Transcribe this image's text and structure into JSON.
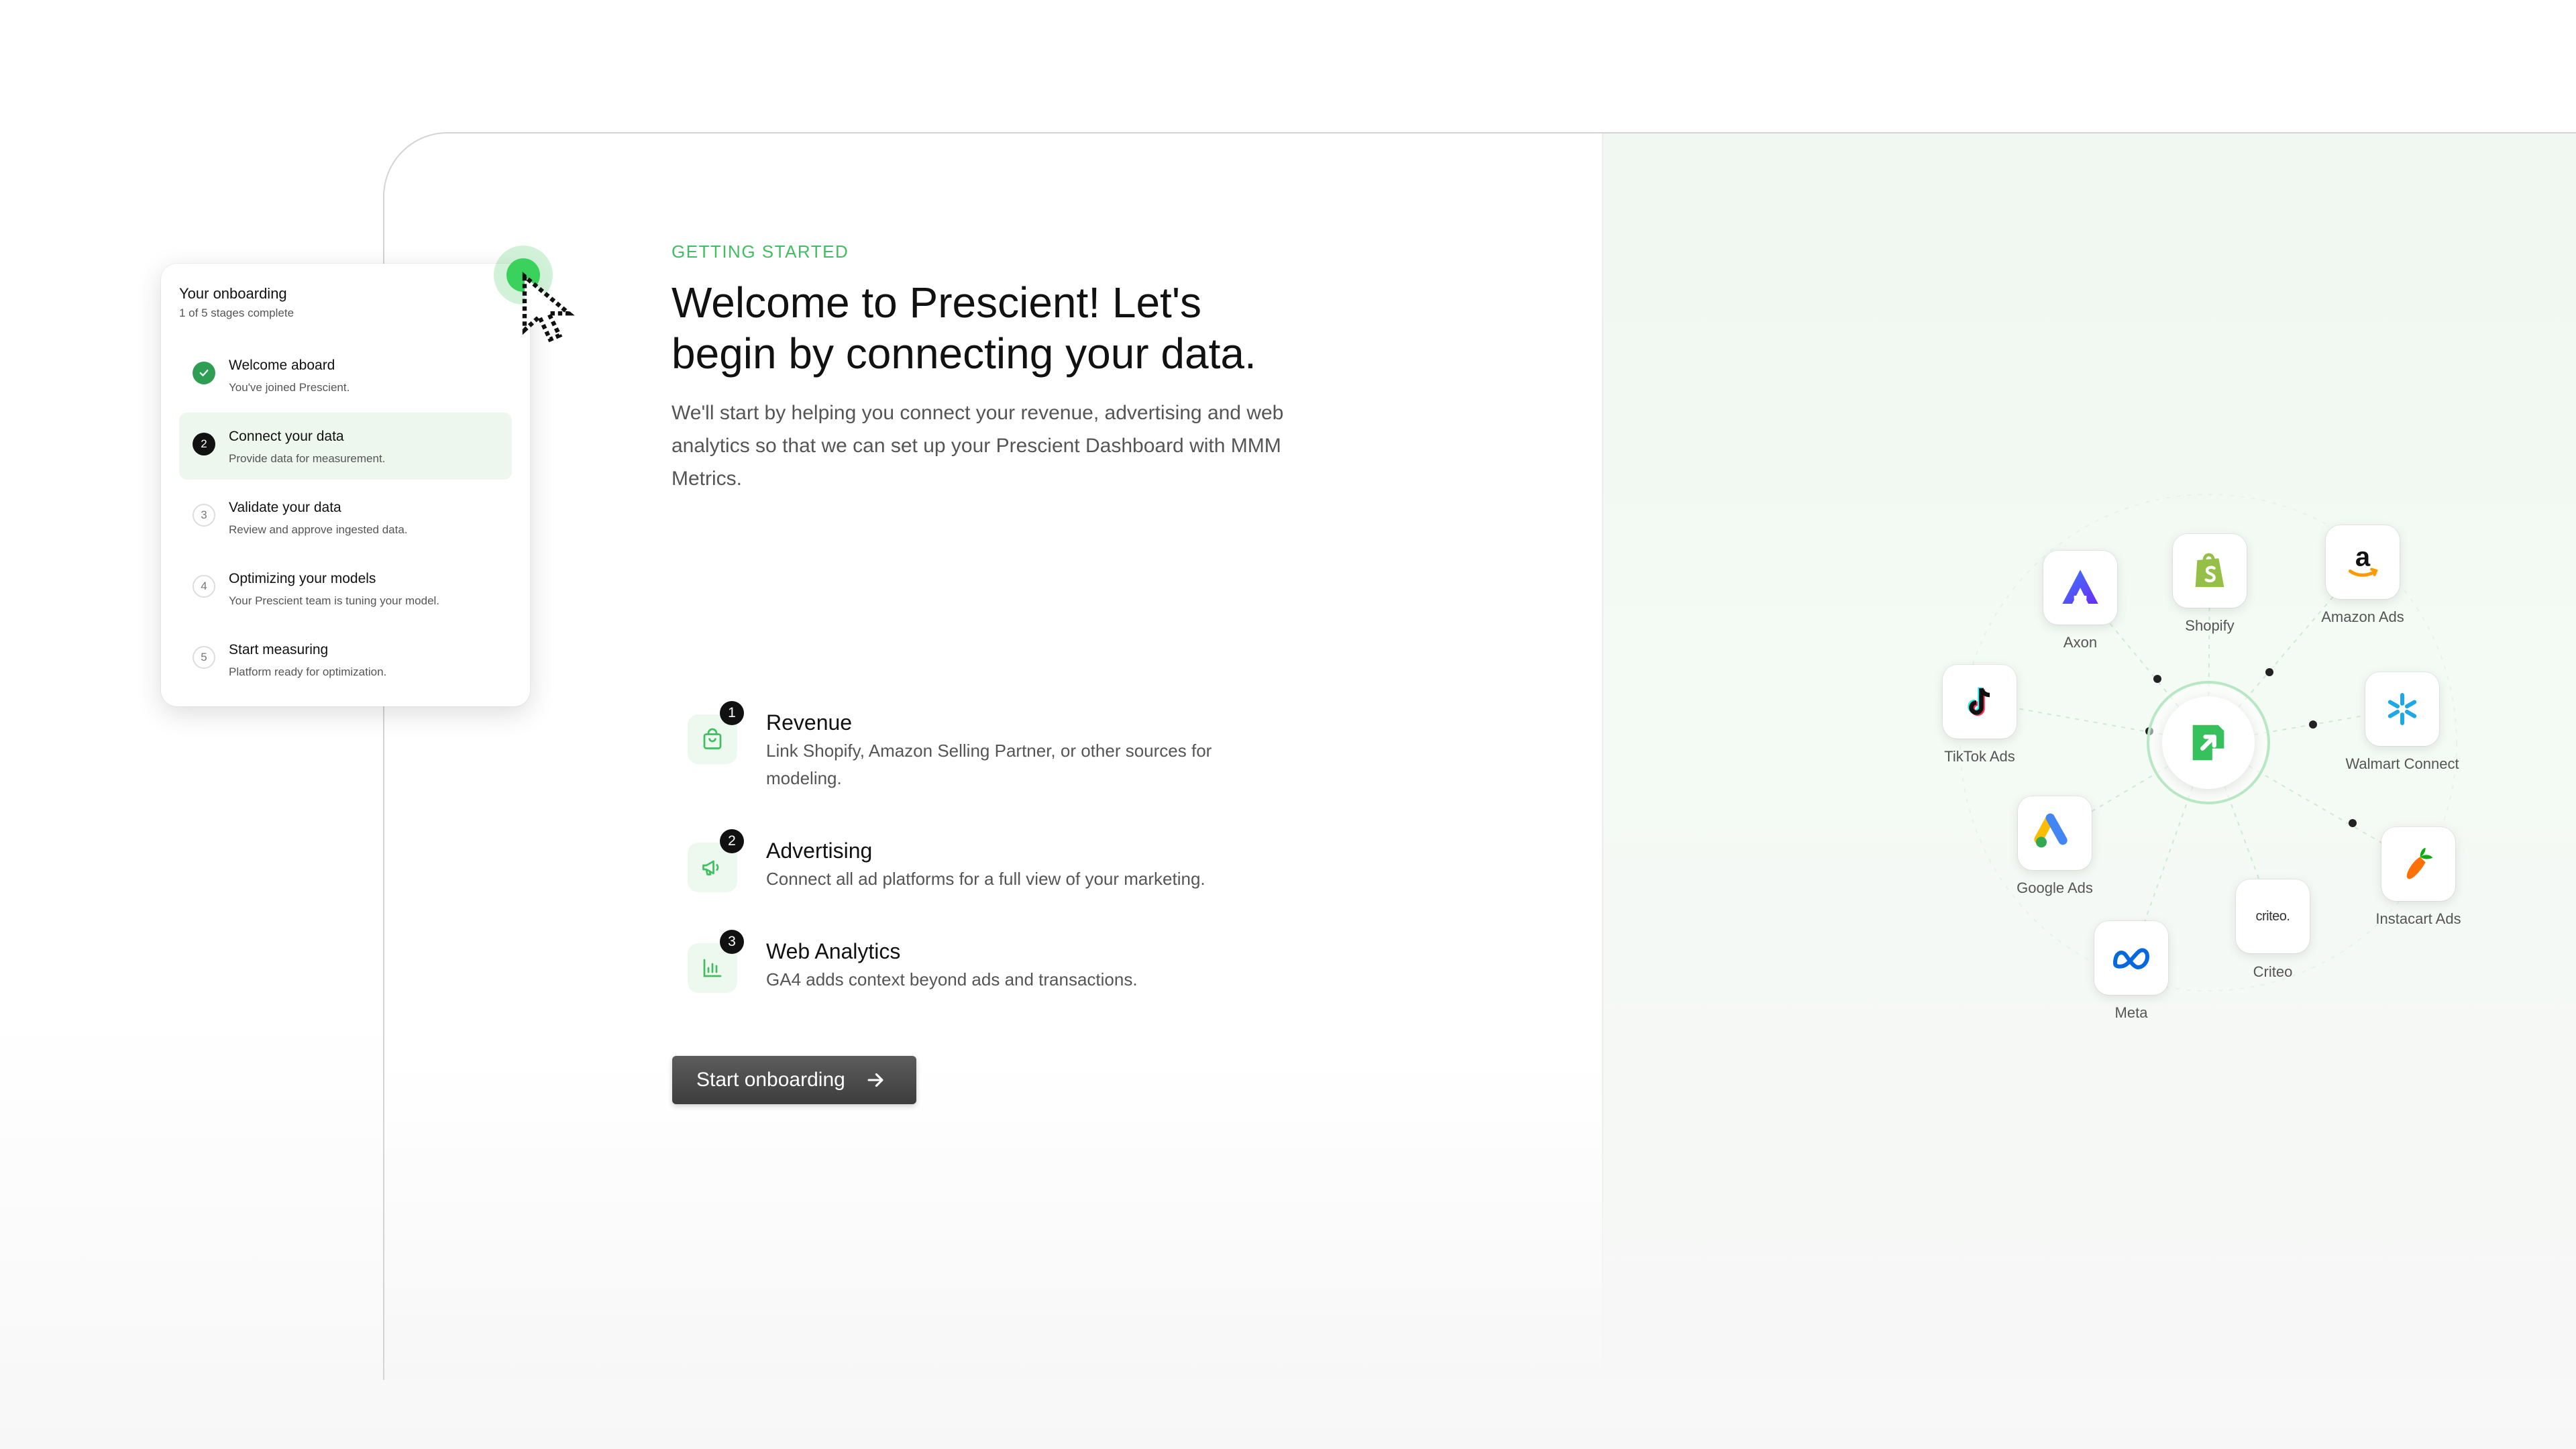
{
  "main": {
    "kicker": "GETTING STARTED",
    "headline_line1": "Welcome to Prescient! Let's",
    "headline_line2": "begin by connecting your data.",
    "intro": "We'll start by helping you connect your revenue, advertising and web analytics so that we can set up your Prescient Dashboard with MMM Metrics.",
    "steps": [
      {
        "number": "1",
        "title": "Revenue",
        "desc_line1": "Link Shopify, Amazon Selling Partner, or other sources for",
        "desc_line2": "modeling.",
        "icon": "shopping-bag-icon"
      },
      {
        "number": "2",
        "title": "Advertising",
        "desc_line1": "Connect all ad platforms for a full view of your marketing.",
        "icon": "megaphone-icon"
      },
      {
        "number": "3",
        "title": "Web Analytics",
        "desc_line1": "GA4 adds context beyond ads and transactions.",
        "icon": "bar-chart-icon"
      }
    ],
    "cta_label": "Start onboarding"
  },
  "onboarding": {
    "title": "Your onboarding",
    "subtitle": "1 of 5 stages complete",
    "items": [
      {
        "number": "",
        "label": "Welcome aboard",
        "desc": "You've joined Prescient.",
        "state": "done"
      },
      {
        "number": "2",
        "label": "Connect your data",
        "desc": "Provide data for measurement.",
        "state": "current"
      },
      {
        "number": "3",
        "label": "Validate your data",
        "desc": "Review and approve ingested data.",
        "state": "pending"
      },
      {
        "number": "4",
        "label": "Optimizing your models",
        "desc": "Your Prescient team is tuning your model.",
        "state": "pending"
      },
      {
        "number": "5",
        "label": "Start measuring",
        "desc": "Platform ready for optimization.",
        "state": "pending"
      }
    ]
  },
  "integrations": [
    {
      "name": "Axon",
      "icon": "axon-logo-icon"
    },
    {
      "name": "Shopify",
      "icon": "shopify-logo-icon"
    },
    {
      "name": "Amazon Ads",
      "icon": "amazon-logo-icon"
    },
    {
      "name": "TikTok Ads",
      "icon": "tiktok-logo-icon"
    },
    {
      "name": "Walmart Connect",
      "icon": "walmart-logo-icon"
    },
    {
      "name": "Google Ads",
      "icon": "google-ads-logo-icon"
    },
    {
      "name": "Instacart Ads",
      "icon": "instacart-logo-icon"
    },
    {
      "name": "Criteo",
      "icon": "criteo-logo-icon",
      "wordmark": "criteo."
    },
    {
      "name": "Meta",
      "icon": "meta-logo-icon"
    }
  ],
  "colors": {
    "accent": "#3fbf5f",
    "button": "#4a4a4a",
    "hub_ring": "#b7e8c3"
  }
}
